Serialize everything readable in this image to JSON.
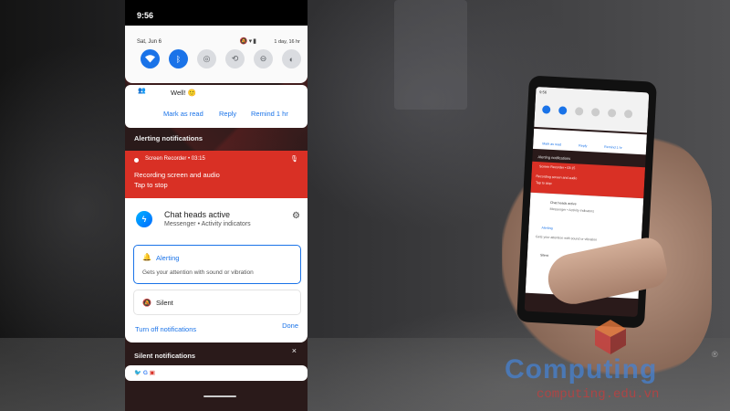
{
  "status_bar": {
    "time": "9:56"
  },
  "quick_settings": {
    "date": "Sat, Jun 6",
    "battery": "1 day, 16 hr",
    "tiles": [
      {
        "icon": "wifi-icon",
        "state": "on"
      },
      {
        "icon": "bluetooth-icon",
        "state": "on"
      },
      {
        "icon": "nfc-icon",
        "state": "off"
      },
      {
        "icon": "auto-rotate-icon",
        "state": "off"
      },
      {
        "icon": "do-not-disturb-icon",
        "state": "off"
      },
      {
        "icon": "dark-theme-icon",
        "state": "off"
      }
    ]
  },
  "reply_notification": {
    "message": "Well! 🙂",
    "actions": [
      "Mark as read",
      "Reply",
      "Remind 1 hr"
    ]
  },
  "alerting_section": {
    "header": "Alerting notifications",
    "screen_recorder": {
      "title": "Screen Recorder • 03:15",
      "line1": "Recording screen and audio",
      "line2": "Tap to stop"
    },
    "chat_heads": {
      "title": "Chat heads active",
      "subtitle": "Messenger • Activity indicators",
      "options": [
        {
          "label": "Alerting",
          "description": "Gets your attention with sound or vibration",
          "selected": true
        },
        {
          "label": "Silent",
          "selected": false
        }
      ],
      "turn_off_label": "Turn off notifications",
      "done_label": "Done"
    }
  },
  "silent_section": {
    "header": "Silent notifications",
    "close": "×"
  },
  "mini_phone": {
    "time": "9:56",
    "alerting_header": "Alerting notifications",
    "recorder_title": "Screen Recorder • 03:15",
    "recorder_line1": "Recording screen and audio",
    "recorder_line2": "Tap to stop",
    "chat_title": "Chat heads active",
    "chat_sub": "Messenger • Activity indicators",
    "alerting_label": "Alerting",
    "alerting_desc": "Gets your attention with sound or vibration",
    "silent_label": "Silent",
    "reply_actions": [
      "Mark as read",
      "Reply",
      "Remind 1 hr"
    ]
  },
  "watermark": {
    "brand": "Computing",
    "reg": "®",
    "url": "computing.edu.vn"
  },
  "colors": {
    "accent": "#1a73e8",
    "recorder_red": "#d93025",
    "messenger_blue": "#0084ff"
  }
}
